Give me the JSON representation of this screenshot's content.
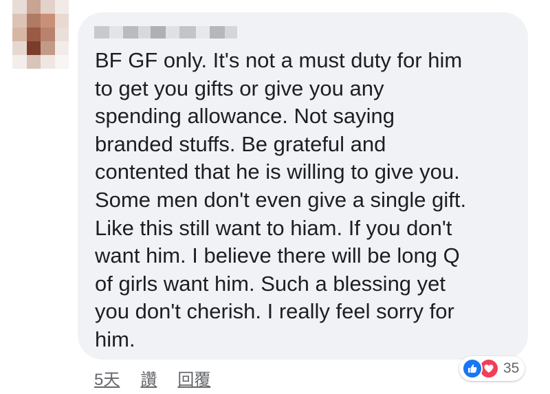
{
  "comment": {
    "text": "BF GF only. It's not a must duty for him\nto get you gifts or give you any\nspending allowance. Not saying\nbranded stuffs. Be grateful and\ncontented that he is willing to give you.\nSome men don't even give a single gift.\nLike this still want to hiam. If you don't\nwant him. I believe there will be long Q\nof girls want him. Such a blessing yet\nyou don't cherish. I really feel sorry for\nhim."
  },
  "actions": {
    "timestamp": "5天",
    "like_label": "讚",
    "reply_label": "回覆"
  },
  "reactions": {
    "count": "35",
    "icons": [
      "like-icon",
      "love-icon"
    ],
    "colors": {
      "like": "#1877f2",
      "love": "#f33e58"
    }
  }
}
